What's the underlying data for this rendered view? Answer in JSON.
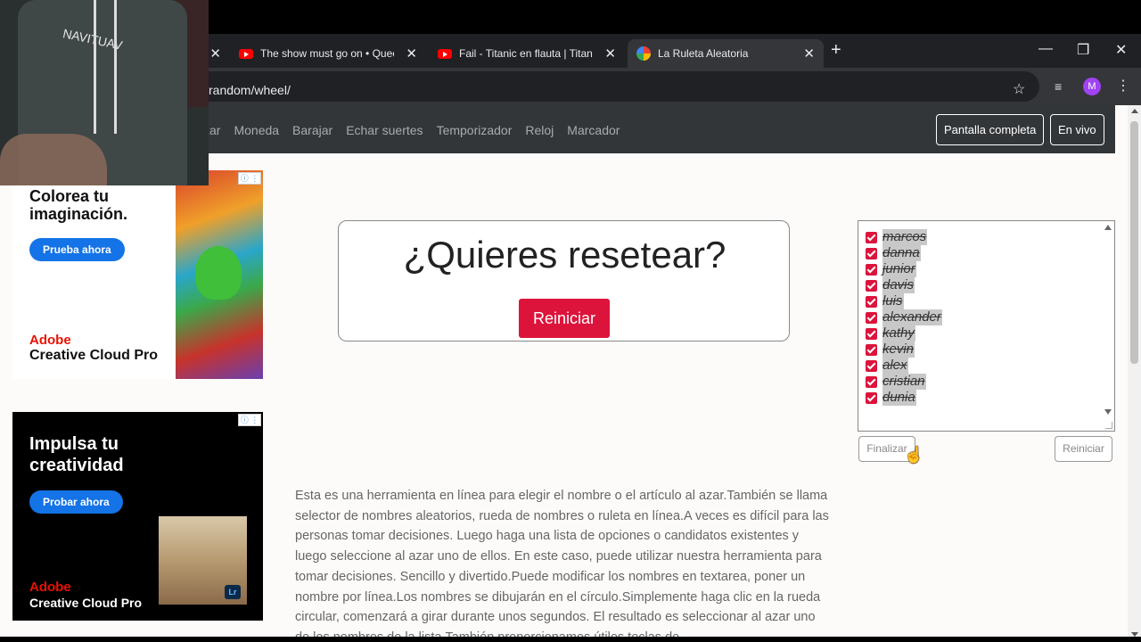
{
  "browser": {
    "tabs": [
      {
        "label": "The show must go on • Queen",
        "icon": "youtube-icon"
      },
      {
        "label": "Fail - Titanic en flauta | Titanic f",
        "icon": "youtube-icon"
      },
      {
        "label": "La Ruleta Aleatoria",
        "icon": "ruleta-favicon"
      }
    ],
    "url": "random/wheel/",
    "avatar_initial": "M"
  },
  "webcam": {
    "hoodie_text": "NAVITUAV"
  },
  "nav": {
    "links": [
      "zar",
      "Moneda",
      "Barajar",
      "Echar suertes",
      "Temporizador",
      "Reloj",
      "Marcador"
    ],
    "fullscreen_label": "Pantalla completa",
    "live_label": "En vivo"
  },
  "ads": [
    {
      "headline": "Colorea tu imaginación.",
      "cta": "Prueba ahora",
      "brand_line1": "Adobe",
      "brand_line2": "Creative Cloud Pro"
    },
    {
      "headline": "Impulsa tu creatividad",
      "cta": "Probar ahora",
      "brand_line1": "Adobe",
      "brand_line2": "Creative Cloud Pro",
      "badge": "Lr"
    }
  ],
  "reset": {
    "title": "¿Quieres resetear?",
    "button": "Reiniciar"
  },
  "names": [
    "marcos",
    "danna",
    "junior",
    "davis",
    "luis",
    "alexander",
    "kathy",
    "kevin",
    "alex",
    "cristian",
    "dunia"
  ],
  "list_buttons": {
    "finish": "Finalizar",
    "reset": "Reiniciar"
  },
  "description": "Esta es una herramienta en línea para elegir el nombre o el artículo al azar.También se llama selector de nombres aleatorios, rueda de nombres o ruleta en línea.A veces es difícil para las personas tomar decisiones. Luego haga una lista de opciones o candidatos existentes y luego seleccione al azar uno de ellos. En este caso, puede utilizar nuestra herramienta para tomar decisiones. Sencillo y divertido.Puede modificar los nombres en textarea, poner un nombre por línea.Los nombres se dibujarán en el círculo.Simplemente haga clic en la rueda circular, comenzará a girar durante unos segundos. El resultado es seleccionar al azar uno de los nombres de la lista.También proporcionamos útiles teclas de"
}
